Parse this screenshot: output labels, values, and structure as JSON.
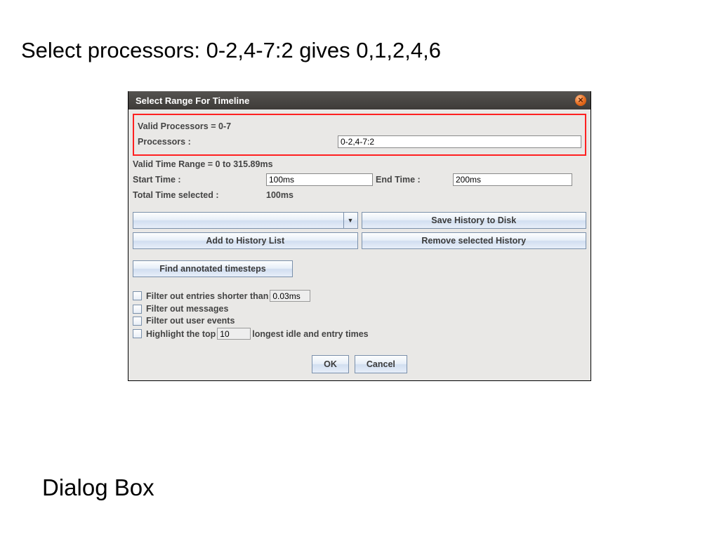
{
  "slide": {
    "title": "Select processors: 0-2,4-7:2 gives 0,1,2,4,6",
    "caption": "Dialog Box"
  },
  "dialog": {
    "title": "Select Range For Timeline",
    "valid_proc": "Valid Processors = 0-7",
    "proc_label": "Processors :",
    "proc_value": "0-2,4-7:2",
    "valid_time": "Valid Time Range = 0 to 315.89ms",
    "start_label": "Start Time :",
    "start_value": "100ms",
    "end_label": "End Time :",
    "end_value": "200ms",
    "total_label": "Total Time selected :",
    "total_value": "100ms",
    "buttons": {
      "save_history": "Save History to Disk",
      "add_history": "Add to History List",
      "remove_history": "Remove selected History",
      "find_annotated": "Find annotated timesteps",
      "ok": "OK",
      "cancel": "Cancel"
    },
    "checks": {
      "filter_short_pre": "Filter out entries shorter than",
      "filter_short_val": "0.03ms",
      "filter_msg": "Filter out messages",
      "filter_user": "Filter out user events",
      "highlight_pre": "Highlight the top",
      "highlight_val": "10",
      "highlight_post": "longest idle and entry times"
    }
  }
}
